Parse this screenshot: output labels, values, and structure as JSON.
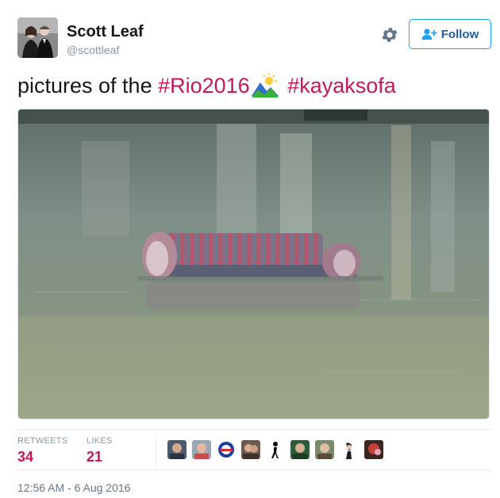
{
  "author": {
    "name": "Scott Leaf",
    "handle": "@scottleaf",
    "follow_label": "Follow"
  },
  "tweet": {
    "text_prefix": "pictures of the ",
    "hashtag_1": "#Rio2016",
    "emoji": "sunrise-over-mountains",
    "hashtag_2": "#kayaksofa"
  },
  "stats": {
    "retweets_label": "RETWEETS",
    "retweets_count": "34",
    "likes_label": "LIKES",
    "likes_count": "21"
  },
  "timestamp": "12:56 AM - 6 Aug 2016",
  "colors": {
    "hashtag": "#c2185b",
    "follow_border": "#1da1f2",
    "follow_text": "#1e5c9b",
    "muted": "#8899a6"
  }
}
